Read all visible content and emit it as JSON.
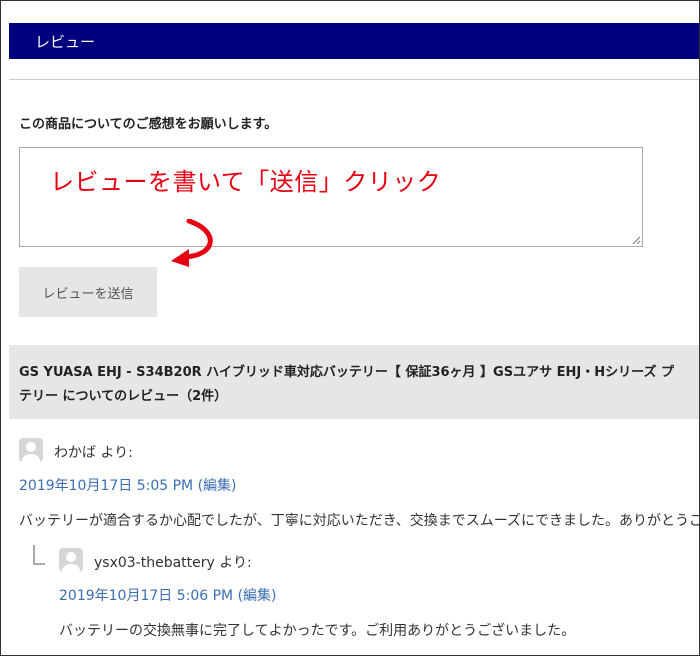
{
  "title_bar": {
    "label": "レビュー"
  },
  "form": {
    "prompt": "この商品についてのご感想をお願いします。",
    "annotation": "レビューを書いて「送信」クリック",
    "submit_label": "レビューを送信",
    "annotation_color": "#e60012"
  },
  "reviews_section": {
    "heading_line1": "GS YUASA EHJ - S34B20R ハイブリッド車対応バッテリー【 保証36ヶ月 】GSユアサ EHJ・Hシリーズ プ",
    "heading_line2": "テリー についてのレビュー（2件）"
  },
  "comments": [
    {
      "author": "わかば より:",
      "date": "2019年10月17日 5:05 PM",
      "edit": "(編集)",
      "text": "バッテリーが適合するか心配でしたが、丁寧に対応いただき、交換までスムーズにできました。ありがとうご"
    },
    {
      "author": "ysx03-thebattery より:",
      "date": "2019年10月17日 5:06 PM",
      "edit": "(編集)",
      "text": "バッテリーの交換無事に完了してよかったです。ご利用ありがとうございました。"
    }
  ],
  "colors": {
    "title_bar_bg": "#00007f",
    "link": "#3a6eb5",
    "panel_bg": "#e6e6e6"
  }
}
